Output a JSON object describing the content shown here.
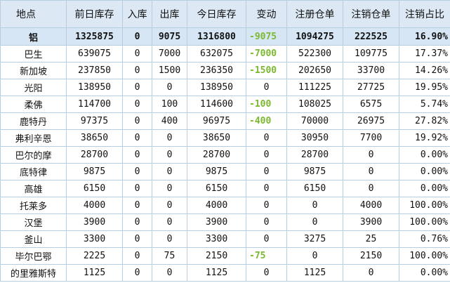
{
  "headers": [
    "地点",
    "前日库存",
    "入库",
    "出库",
    "今日库存",
    "变动",
    "注册仓单",
    "注销仓单",
    "注销占比"
  ],
  "total": {
    "loc": "铝",
    "prev": "1325875",
    "in": "0",
    "out": "9075",
    "today": "1316800",
    "change": "-9075",
    "reg": "1094275",
    "cancel": "222525",
    "ratio": "16.90%"
  },
  "rows": [
    {
      "loc": "巴生",
      "prev": "639075",
      "in": "0",
      "out": "7000",
      "today": "632075",
      "change": "-7000",
      "reg": "522300",
      "cancel": "109775",
      "ratio": "17.37%"
    },
    {
      "loc": "新加坡",
      "prev": "237850",
      "in": "0",
      "out": "1500",
      "today": "236350",
      "change": "-1500",
      "reg": "202650",
      "cancel": "33700",
      "ratio": "14.26%"
    },
    {
      "loc": "光阳",
      "prev": "138950",
      "in": "0",
      "out": "0",
      "today": "138950",
      "change": "0",
      "reg": "111225",
      "cancel": "27725",
      "ratio": "19.95%"
    },
    {
      "loc": "柔佛",
      "prev": "114700",
      "in": "0",
      "out": "100",
      "today": "114600",
      "change": "-100",
      "reg": "108025",
      "cancel": "6575",
      "ratio": "5.74%"
    },
    {
      "loc": "鹿特丹",
      "prev": "97375",
      "in": "0",
      "out": "400",
      "today": "96975",
      "change": "-400",
      "reg": "70000",
      "cancel": "26975",
      "ratio": "27.82%"
    },
    {
      "loc": "弗利辛恩",
      "prev": "38650",
      "in": "0",
      "out": "0",
      "today": "38650",
      "change": "0",
      "reg": "30950",
      "cancel": "7700",
      "ratio": "19.92%"
    },
    {
      "loc": "巴尔的摩",
      "prev": "28700",
      "in": "0",
      "out": "0",
      "today": "28700",
      "change": "0",
      "reg": "28700",
      "cancel": "0",
      "ratio": "0.00%"
    },
    {
      "loc": "底特律",
      "prev": "9875",
      "in": "0",
      "out": "0",
      "today": "9875",
      "change": "0",
      "reg": "9875",
      "cancel": "0",
      "ratio": "0.00%"
    },
    {
      "loc": "高雄",
      "prev": "6150",
      "in": "0",
      "out": "0",
      "today": "6150",
      "change": "0",
      "reg": "6150",
      "cancel": "0",
      "ratio": "0.00%"
    },
    {
      "loc": "托莱多",
      "prev": "4000",
      "in": "0",
      "out": "0",
      "today": "4000",
      "change": "0",
      "reg": "0",
      "cancel": "4000",
      "ratio": "100.00%"
    },
    {
      "loc": "汉堡",
      "prev": "3900",
      "in": "0",
      "out": "0",
      "today": "3900",
      "change": "0",
      "reg": "0",
      "cancel": "3900",
      "ratio": "100.00%"
    },
    {
      "loc": "釜山",
      "prev": "3300",
      "in": "0",
      "out": "0",
      "today": "3300",
      "change": "0",
      "reg": "3275",
      "cancel": "25",
      "ratio": "0.76%"
    },
    {
      "loc": "毕尔巴鄂",
      "prev": "2225",
      "in": "0",
      "out": "75",
      "today": "2150",
      "change": "-75",
      "reg": "0",
      "cancel": "2150",
      "ratio": "100.00%"
    },
    {
      "loc": "的里雅斯特",
      "prev": "1125",
      "in": "0",
      "out": "0",
      "today": "1125",
      "change": "0",
      "reg": "1125",
      "cancel": "0",
      "ratio": "0.00%"
    }
  ],
  "colors": {
    "header_bg": "#dce8f4",
    "total_bg": "#d6e6f5",
    "grid": "#b7cde0",
    "negative": "#7cb82f"
  }
}
